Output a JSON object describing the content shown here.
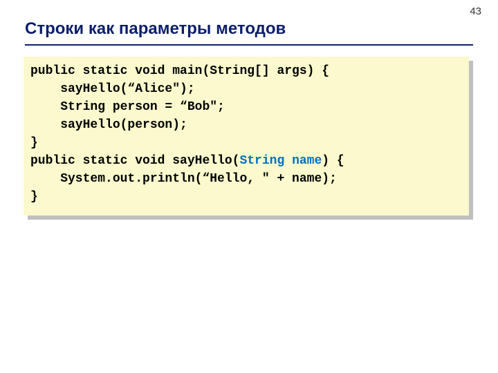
{
  "page_number": "43",
  "title": "Строки как параметры методов",
  "code": {
    "line1": "public static void main(String[] args) {",
    "line2": "    sayHello(“Alice\");",
    "line3": "    String person = “Bob\";",
    "line4": "    sayHello(person);",
    "line5": "}",
    "line6_a": "public static void sayHello(",
    "line6_b": "String name",
    "line6_c": ") {",
    "line7": "    System.out.println(“Hello, \" + name);",
    "line8": "}"
  }
}
